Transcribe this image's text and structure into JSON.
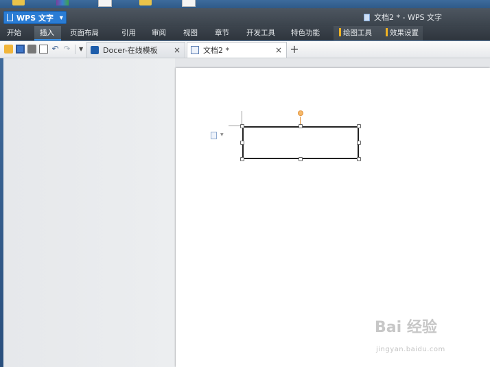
{
  "app": {
    "name": "WPS 文字",
    "window_title": "文档2 * - WPS 文字"
  },
  "ribbon": {
    "tabs": [
      {
        "label": "开始",
        "active": false,
        "contextual": false
      },
      {
        "label": "插入",
        "active": true,
        "contextual": false
      },
      {
        "label": "页面布局",
        "active": false,
        "contextual": false
      },
      {
        "label": "引用",
        "active": false,
        "contextual": false
      },
      {
        "label": "审阅",
        "active": false,
        "contextual": false
      },
      {
        "label": "视图",
        "active": false,
        "contextual": false
      },
      {
        "label": "章节",
        "active": false,
        "contextual": false
      },
      {
        "label": "开发工具",
        "active": false,
        "contextual": false
      },
      {
        "label": "特色功能",
        "active": false,
        "contextual": false
      },
      {
        "label": "绘图工具",
        "active": false,
        "contextual": true
      },
      {
        "label": "效果设置",
        "active": false,
        "contextual": true
      }
    ]
  },
  "quick_access": {
    "icons": [
      "open-folder-icon",
      "save-icon",
      "print-icon",
      "print-preview-icon",
      "undo-icon",
      "redo-icon"
    ]
  },
  "doc_tabs": {
    "docer": {
      "label": "Docer-在线模板",
      "close": "×"
    },
    "doc2": {
      "label": "文档2 *",
      "close": "×"
    },
    "add": "+"
  },
  "watermark": {
    "brand": "Bai 经验",
    "url": "jingyan.baidu.com"
  },
  "colors": {
    "accent": "#2a7cd4",
    "ribbon_bg": "#3c444d",
    "contextual_marker": "#f0b323",
    "rotation_handle": "#f6b969"
  }
}
